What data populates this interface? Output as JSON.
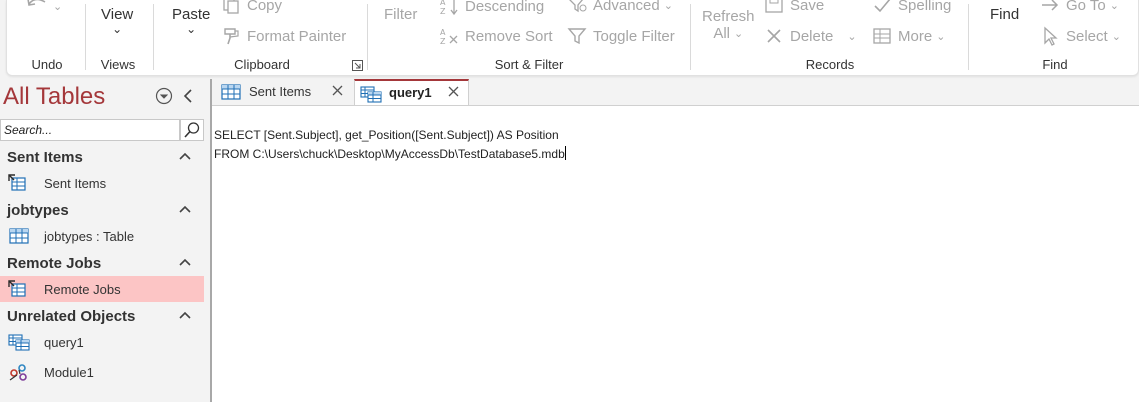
{
  "ribbon": {
    "groups": {
      "undo": "Undo",
      "views": "Views",
      "clipboard": "Clipboard",
      "sort_filter": "Sort & Filter",
      "records": "Records",
      "find": "Find"
    },
    "view_label": "View",
    "paste_label": "Paste",
    "copy_label": "Copy",
    "format_painter_label": "Format Painter",
    "filter_label": "Filter",
    "descending_label": "Descending",
    "remove_sort_label": "Remove Sort",
    "advanced_label": "Advanced",
    "toggle_filter_label": "Toggle Filter",
    "refresh_label": "Refresh",
    "refresh_all_label": "All",
    "save_label": "Save",
    "delete_label": "Delete",
    "spelling_label": "Spelling",
    "more_label": "More",
    "find_label": "Find",
    "goto_label": "Go To",
    "select_label": "Select"
  },
  "nav": {
    "title": "All Tables",
    "search_placeholder": "Search...",
    "groups": [
      {
        "header": "Sent Items",
        "items": [
          {
            "label": "Sent Items",
            "icon": "linked-table-icon"
          }
        ]
      },
      {
        "header": "jobtypes",
        "items": [
          {
            "label": "jobtypes : Table",
            "icon": "table-icon"
          }
        ]
      },
      {
        "header": "Remote Jobs",
        "items": [
          {
            "label": "Remote Jobs",
            "icon": "linked-table-icon",
            "selected": true
          }
        ]
      },
      {
        "header": "Unrelated Objects",
        "items": [
          {
            "label": "query1",
            "icon": "query-icon"
          },
          {
            "label": "Module1",
            "icon": "module-icon"
          }
        ]
      }
    ]
  },
  "tabs": [
    {
      "label": "Sent Items",
      "active": false
    },
    {
      "label": "query1",
      "active": true
    }
  ],
  "editor": {
    "lines": [
      "SELECT [Sent.Subject], get_Position([Sent.Subject]) AS Position",
      "FROM C:\\Users\\chuck\\Desktop\\MyAccessDb\\TestDatabase5.mdb"
    ]
  },
  "colors": {
    "accent": "#a4373a",
    "selected_item": "#fcc5c5",
    "disabled_text": "#a6a6a6"
  }
}
